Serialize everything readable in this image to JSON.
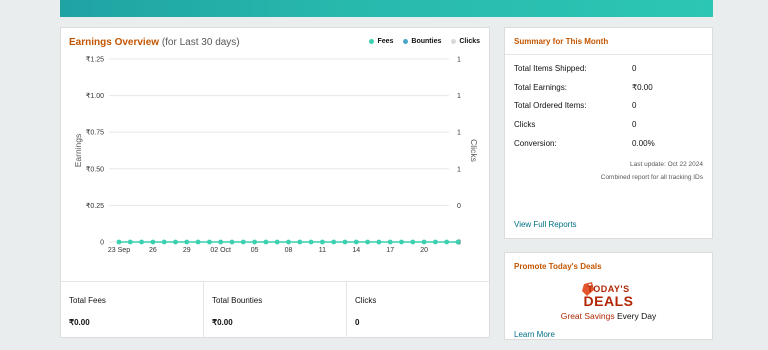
{
  "overview": {
    "title": "Earnings Overview",
    "subtitle": "(for Last 30 days)",
    "legend": [
      {
        "name": "Fees",
        "color": "#3ccfb0"
      },
      {
        "name": "Bounties",
        "color": "#4aa5c8"
      },
      {
        "name": "Clicks",
        "color": "#d5d9d9"
      }
    ]
  },
  "chart_data": {
    "type": "line",
    "ylabel_left": "Earnings",
    "ylabel_right": "Clicks",
    "left_ticks": [
      "₹1.25",
      "₹1.00",
      "₹0.75",
      "₹0.50",
      "₹0.25",
      "0"
    ],
    "right_ticks": [
      "1",
      "1",
      "1",
      "1",
      "0",
      "0"
    ],
    "x_tick_labels": [
      "23 Sep",
      "26",
      "29",
      "02 Oct",
      "05",
      "08",
      "11",
      "14",
      "17",
      "20"
    ],
    "ylim": [
      0,
      1.25
    ],
    "grid": true,
    "series": [
      {
        "name": "Fees",
        "values": [
          0,
          0,
          0,
          0,
          0,
          0,
          0,
          0,
          0,
          0,
          0,
          0,
          0,
          0,
          0,
          0,
          0,
          0,
          0,
          0,
          0,
          0,
          0,
          0,
          0,
          0,
          0,
          0,
          0,
          0,
          0
        ]
      }
    ]
  },
  "totals": [
    {
      "label": "Total Fees",
      "value": "₹0.00"
    },
    {
      "label": "Total Bounties",
      "value": "₹0.00"
    },
    {
      "label": "Clicks",
      "value": "0"
    }
  ],
  "summary": {
    "title": "Summary for This Month",
    "rows": [
      {
        "label": "Total Items Shipped:",
        "value": "0"
      },
      {
        "label": "Total Earnings:",
        "value": "₹0.00"
      },
      {
        "label": "Total Ordered Items:",
        "value": "0"
      },
      {
        "label": "Clicks",
        "value": "0"
      },
      {
        "label": "Conversion:",
        "value": "0.00%"
      }
    ],
    "last_update": "Last update: Oct 22 2024",
    "combined": "Combined report for all tracking IDs",
    "link": "View Full Reports"
  },
  "promo": {
    "title": "Promote Today's Deals",
    "deals_line1": "TODAY'S",
    "deals_line2": "DEALS",
    "tagline_red": "Great Savings",
    "tagline_rest": " Every Day",
    "link": "Learn More"
  }
}
